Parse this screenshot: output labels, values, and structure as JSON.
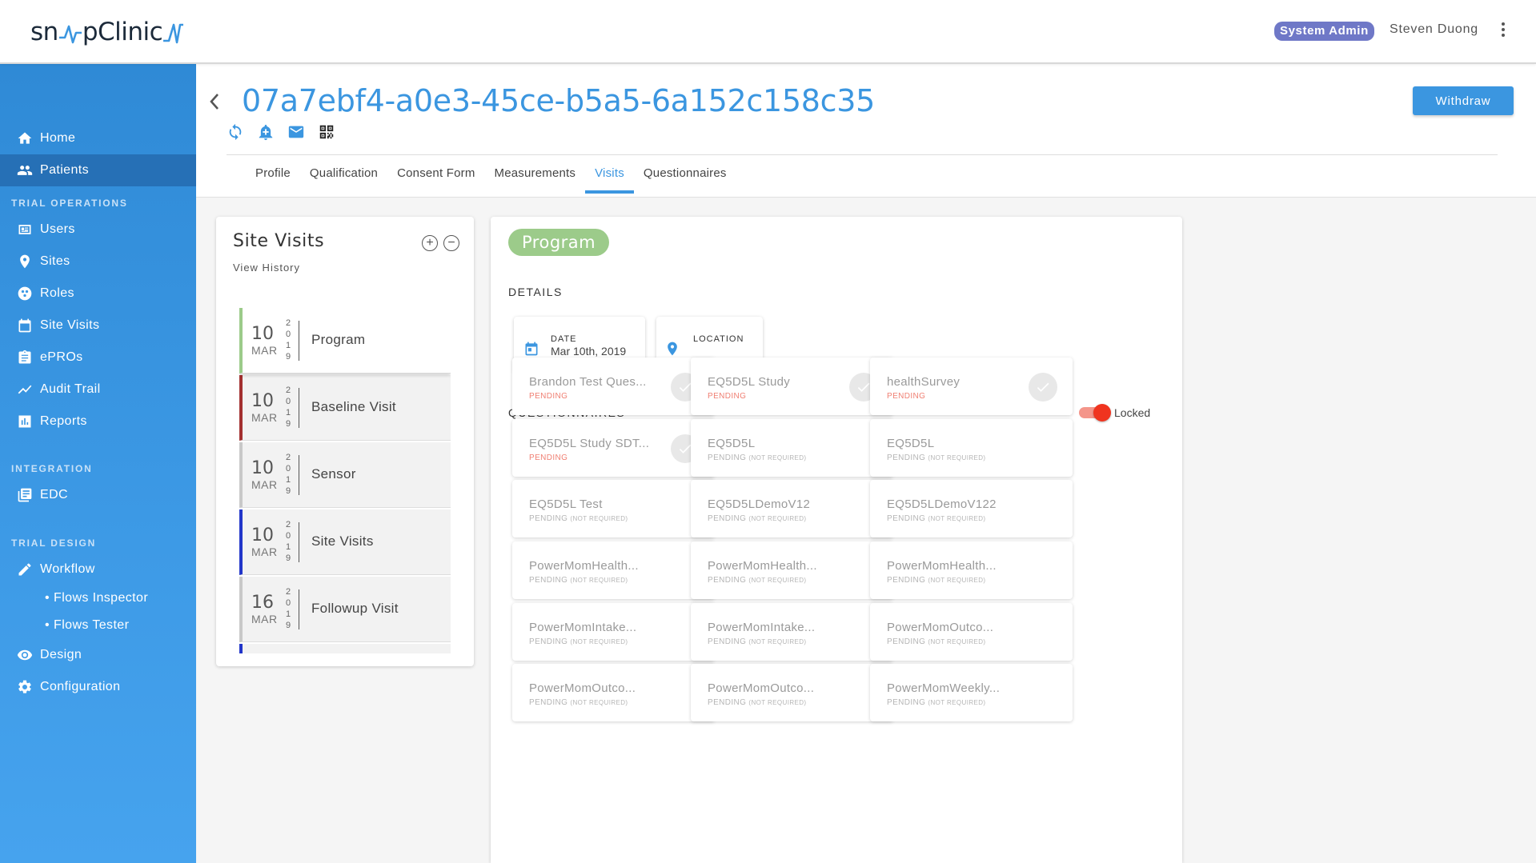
{
  "app": {
    "logo_text_left": "sn",
    "logo_text_right": "pClinic",
    "role_badge": "System Admin",
    "user_name": "Steven Duong"
  },
  "sidebar": {
    "items": [
      {
        "label": "Home",
        "icon": "home-icon"
      },
      {
        "label": "Patients",
        "icon": "people-icon",
        "active": true
      }
    ],
    "sections": [
      {
        "title": "TRIAL OPERATIONS",
        "items": [
          {
            "label": "Users",
            "icon": "id-card-icon"
          },
          {
            "label": "Sites",
            "icon": "map-pin-icon"
          },
          {
            "label": "Roles",
            "icon": "roles-icon"
          },
          {
            "label": "Site Visits",
            "icon": "calendar-icon"
          },
          {
            "label": "ePROs",
            "icon": "clipboard-icon"
          },
          {
            "label": "Audit Trail",
            "icon": "trend-icon"
          },
          {
            "label": "Reports",
            "icon": "bar-chart-icon"
          }
        ]
      },
      {
        "title": "INTEGRATION",
        "items": [
          {
            "label": "EDC",
            "icon": "library-icon"
          }
        ]
      },
      {
        "title": "TRIAL DESIGN",
        "items": [
          {
            "label": "Workflow",
            "icon": "pencil-icon"
          },
          {
            "label": "Flows Inspector",
            "sub": true
          },
          {
            "label": "Flows Tester",
            "sub": true
          },
          {
            "label": "Design",
            "icon": "eye-icon"
          },
          {
            "label": "Configuration",
            "icon": "gear-icon"
          }
        ]
      }
    ]
  },
  "header": {
    "patient_id": "07a7ebf4-a0e3-45ce-b5a5-6a152c158c35",
    "withdraw_label": "Withdraw",
    "tabs": [
      "Profile",
      "Qualification",
      "Consent Form",
      "Measurements",
      "Visits",
      "Questionnaires"
    ],
    "active_tab": "Visits"
  },
  "site_visits": {
    "title": "Site Visits",
    "subtitle": "View History",
    "visits": [
      {
        "day": "10",
        "month": "MAR",
        "year": [
          "2",
          "0",
          "1",
          "9"
        ],
        "name": "Program",
        "color": "#9ccb8a",
        "active": true
      },
      {
        "day": "10",
        "month": "MAR",
        "year": [
          "2",
          "0",
          "1",
          "9"
        ],
        "name": "Baseline Visit",
        "color": "#a33030"
      },
      {
        "day": "10",
        "month": "MAR",
        "year": [
          "2",
          "0",
          "1",
          "9"
        ],
        "name": "Sensor",
        "color": "#c8c8c8"
      },
      {
        "day": "10",
        "month": "MAR",
        "year": [
          "2",
          "0",
          "1",
          "9"
        ],
        "name": "Site Visits",
        "color": "#2236c9"
      },
      {
        "day": "16",
        "month": "MAR",
        "year": [
          "2",
          "0",
          "1",
          "9"
        ],
        "name": "Followup Visit",
        "color": "#c8c8c8"
      },
      {
        "day": "",
        "month": "",
        "year": [
          "",
          "",
          "",
          ""
        ],
        "name": "",
        "color": "#2236c9"
      }
    ]
  },
  "program": {
    "title": "Program",
    "details_label": "DETAILS",
    "date_label": "DATE",
    "date_value": "Mar 10th, 2019",
    "location_label": "LOCATION",
    "location_value": "",
    "questionnaires_label": "QUESTIONNAIRES",
    "lock_label": "Locked",
    "questionnaires": [
      {
        "name": "Brandon Test Ques...",
        "status": "PENDING",
        "note": "",
        "done": true
      },
      {
        "name": "EQ5D5L Study",
        "status": "PENDING",
        "note": "",
        "done": true
      },
      {
        "name": "healthSurvey",
        "status": "PENDING",
        "note": "",
        "done": true
      },
      {
        "name": "EQ5D5L Study SDT...",
        "status": "PENDING",
        "note": "",
        "done": true
      },
      {
        "name": "EQ5D5L",
        "status": "PENDING",
        "note": "(NOT REQUIRED)",
        "done": false
      },
      {
        "name": "EQ5D5L",
        "status": "PENDING",
        "note": "(NOT REQUIRED)",
        "done": false
      },
      {
        "name": "EQ5D5L Test",
        "status": "PENDING",
        "note": "(NOT REQUIRED)",
        "done": false
      },
      {
        "name": "EQ5D5LDemoV12",
        "status": "PENDING",
        "note": "(NOT REQUIRED)",
        "done": false
      },
      {
        "name": "EQ5D5LDemoV122",
        "status": "PENDING",
        "note": "(NOT REQUIRED)",
        "done": false
      },
      {
        "name": "PowerMomHealth...",
        "status": "PENDING",
        "note": "(NOT REQUIRED)",
        "done": false
      },
      {
        "name": "PowerMomHealth...",
        "status": "PENDING",
        "note": "(NOT REQUIRED)",
        "done": false
      },
      {
        "name": "PowerMomHealth...",
        "status": "PENDING",
        "note": "(NOT REQUIRED)",
        "done": false
      },
      {
        "name": "PowerMomIntake...",
        "status": "PENDING",
        "note": "(NOT REQUIRED)",
        "done": false
      },
      {
        "name": "PowerMomIntake...",
        "status": "PENDING",
        "note": "(NOT REQUIRED)",
        "done": false
      },
      {
        "name": "PowerMomOutco...",
        "status": "PENDING",
        "note": "(NOT REQUIRED)",
        "done": false
      },
      {
        "name": "PowerMomOutco...",
        "status": "PENDING",
        "note": "(NOT REQUIRED)",
        "done": false
      },
      {
        "name": "PowerMomOutco...",
        "status": "PENDING",
        "note": "(NOT REQUIRED)",
        "done": false
      },
      {
        "name": "PowerMomWeekly...",
        "status": "PENDING",
        "note": "(NOT REQUIRED)",
        "done": false
      }
    ]
  },
  "colors": {
    "accent": "#3b96e0",
    "sidebar": "#3d9ae6",
    "pending_red": "#f07f72",
    "program_green": "#9ccb8a"
  }
}
